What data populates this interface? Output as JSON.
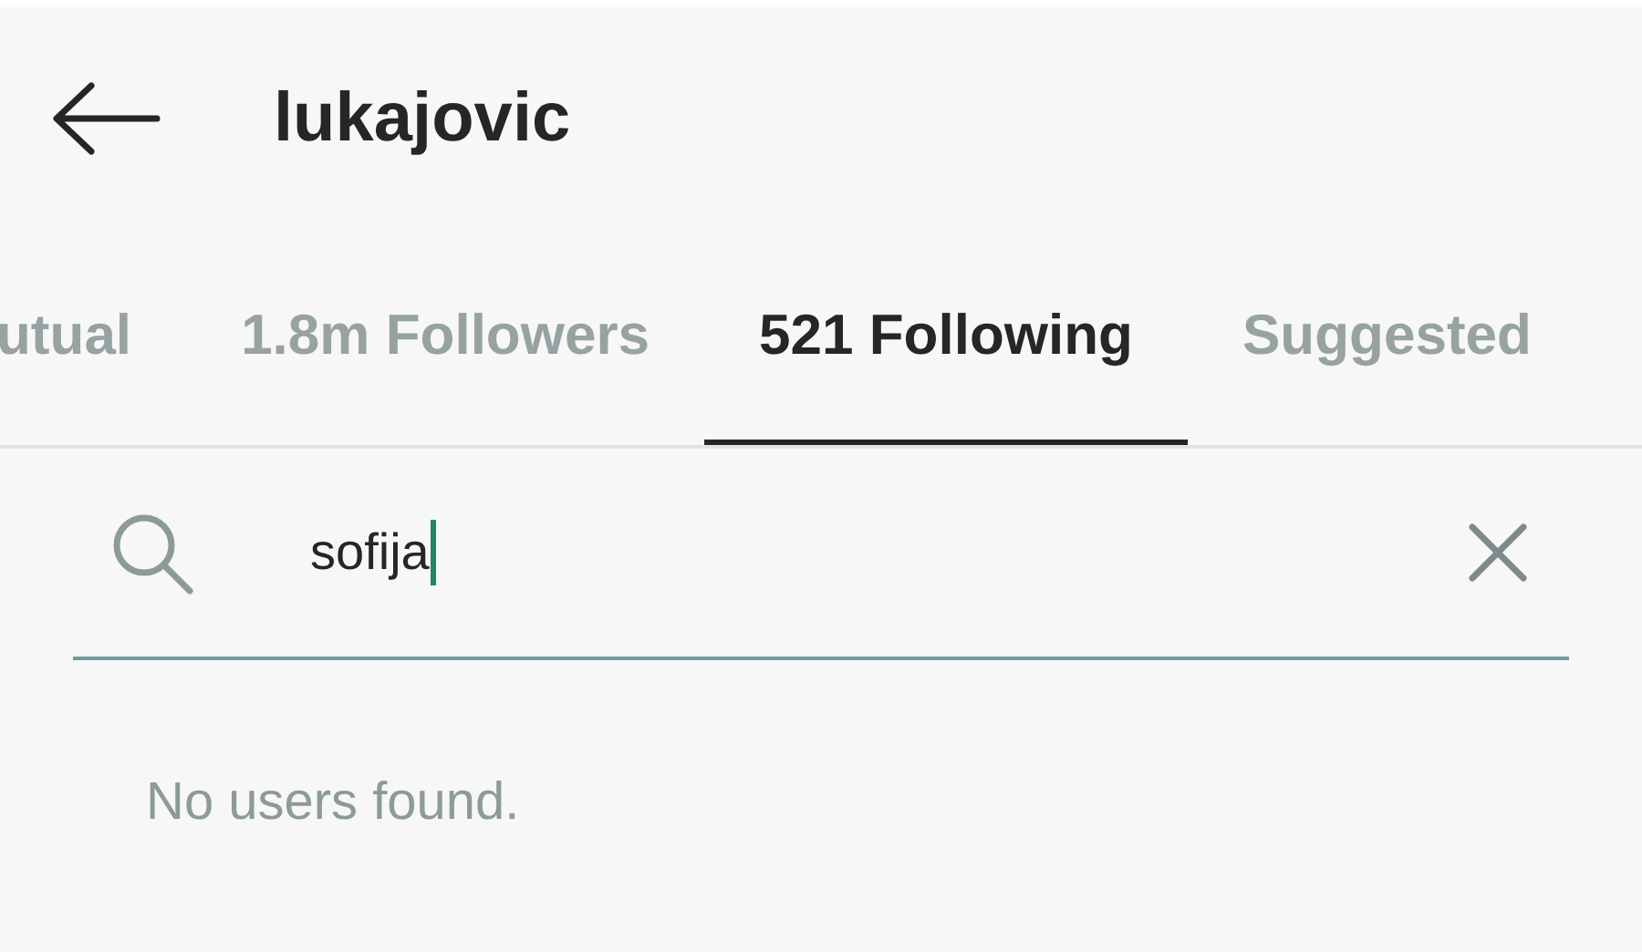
{
  "header": {
    "title": "lukajovic"
  },
  "tabs": [
    {
      "label": "utual",
      "selected": false
    },
    {
      "label": "1.8m Followers",
      "selected": false
    },
    {
      "label": "521 Following",
      "selected": true
    },
    {
      "label": "Suggested",
      "selected": false
    }
  ],
  "search": {
    "value": "sofija"
  },
  "message": "No users found."
}
